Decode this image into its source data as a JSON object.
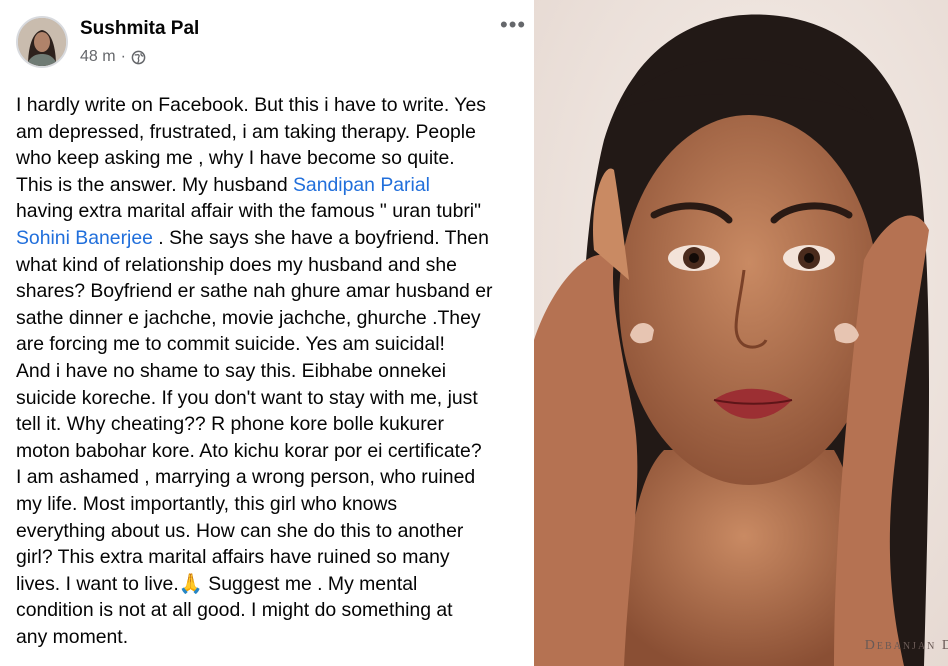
{
  "post": {
    "author_name": "Sushmita Pal",
    "timestamp": "48 m",
    "separator": "·",
    "privacy_icon": "globe-icon",
    "more_options_label": "•••",
    "more_options_icon": "more-horizontal-icon",
    "text_color": "#050505",
    "mention_color": "#216fdb",
    "meta_color": "#65676b",
    "lines": [
      {
        "t": "I hardly write on Facebook. But this i have to write. Yes"
      },
      {
        "t": "am depressed, frustrated, i am taking therapy.  People"
      },
      {
        "t": "who keep asking me , why I have become so quite."
      },
      {
        "t": "This is the answer. My husband ",
        "mention": "Sandipan Parial"
      },
      {
        "t": "having extra marital affair with the famous \" uran tubri\""
      },
      {
        "mention": "Sohini Banerjee",
        "t2": " . She says she  have a boyfriend. Then"
      },
      {
        "t": "what kind of relationship does my husband and she"
      },
      {
        "t": "shares? Boyfriend er sathe nah ghure amar husband er"
      },
      {
        "t": "sathe dinner e jachche, movie jachche, ghurche .They"
      },
      {
        "t": "are forcing me to commit suicide. Yes am suicidal!"
      },
      {
        "t": "And i have no shame to say this. Eibhabe onnekei"
      },
      {
        "t": "suicide koreche. If you don't want to stay with me, just"
      },
      {
        "t": "tell it. Why cheating?? R phone kore bolle kukurer"
      },
      {
        "t": "moton babohar kore. Ato kichu korar por ei certificate?"
      },
      {
        "t": "I am ashamed , marrying a wrong person, who ruined"
      },
      {
        "t": "my life. Most importantly, this girl who knows"
      },
      {
        "t": "everything about us. How can she do this to another"
      },
      {
        "t": "girl? This extra marital affairs have ruined so many"
      },
      {
        "t": "lives. I want to live.",
        "emoji": "🙏",
        "t2": " Suggest me . My mental"
      },
      {
        "t": "condition is not at all good. I might do something at"
      },
      {
        "t": "any moment."
      }
    ]
  },
  "photo": {
    "credit": "Debanjan D"
  }
}
